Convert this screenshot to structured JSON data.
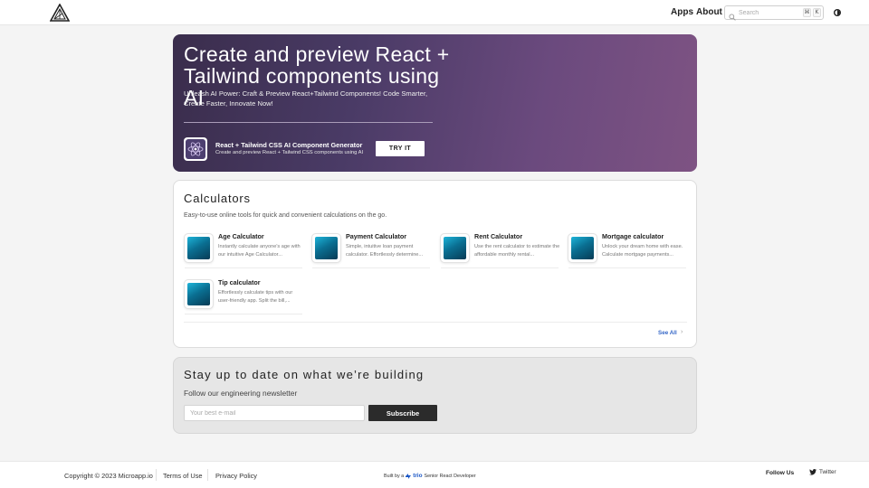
{
  "header": {
    "nav": {
      "apps": "Apps",
      "about": "About"
    },
    "search": {
      "placeholder": "Search",
      "kbd_cmd": "⌘",
      "kbd_key": "K"
    }
  },
  "hero": {
    "title": "Create and preview React + Tailwind components using AI",
    "subtitle": "Unleash AI Power: Craft & Preview React+Tailwind Components! Code Smarter, Create Faster, Innovate Now!",
    "generator_title": "React + Tailwind CSS AI Component Generator",
    "generator_subtitle": "Create and preview React + Tailwind CSS components using AI",
    "cta": "TRY IT"
  },
  "calculators": {
    "title": "Calculators",
    "description": "Easy-to-use online tools for quick and convenient calculations on the go.",
    "tools": [
      {
        "name": "Age Calculator",
        "description": "Instantly calculate anyone's age with our intuitive Age Calculator..."
      },
      {
        "name": "Payment Calculator",
        "description": "Simple, intuitive loan payment calculator. Effortlessly determine..."
      },
      {
        "name": "Rent Calculator",
        "description": "Use the rent calculator to estimate the affordable monthly rental..."
      },
      {
        "name": "Mortgage calculator",
        "description": "Unlock your dream home with ease. Calculate mortgage payments..."
      },
      {
        "name": "Tip calculator",
        "description": "Effortlessly calculate tips with our user-friendly app. Split the bill,..."
      }
    ],
    "see_all": "See All"
  },
  "newsletter": {
    "title": "Stay up to date on what we’re building",
    "subtitle": "Follow our engineering newsletter",
    "email_placeholder": "Your best e-mail",
    "button": "Subscribe"
  },
  "footer": {
    "copyright": "Copyright © 2023 Microapp.io",
    "terms": "Terms of Use",
    "privacy": "Privacy Policy",
    "built_prefix": "Built by a",
    "trio": "trio",
    "built_suffix": "Senior React Developer",
    "follow": "Follow Us",
    "twitter": "Twitter"
  },
  "colors": {
    "hero_gradient_start": "#3a2d4c",
    "hero_gradient_end": "#7e5383",
    "tool_icon_gradient": "#0a6f92",
    "link_blue": "#3567c7",
    "subscribe_bg": "#2b2b2b"
  },
  "icons": {
    "logo": "triangle-logo-icon",
    "search": "search-icon",
    "theme": "moon-icon",
    "generator": "react-ai-icon",
    "see_all": "chevron-right-icon",
    "trio": "trio-logo-icon",
    "twitter": "twitter-icon"
  }
}
